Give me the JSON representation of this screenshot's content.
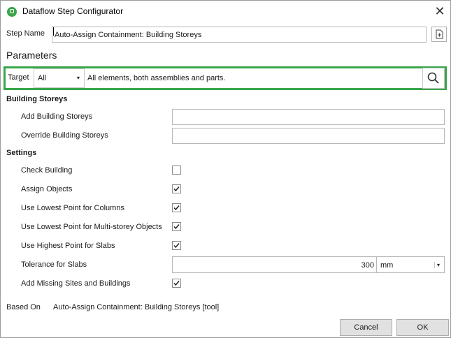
{
  "window": {
    "title": "Dataflow Step Configurator"
  },
  "step": {
    "label": "Step Name",
    "value": "Auto-Assign Containment: Building Storeys"
  },
  "parameters": {
    "heading": "Parameters"
  },
  "target": {
    "label": "Target",
    "selected": "All",
    "description": "All elements, both assemblies and parts."
  },
  "storeys": {
    "heading": "Building Storeys",
    "add_label": "Add Building Storeys",
    "add_value": "",
    "override_label": "Override Building Storeys",
    "override_value": ""
  },
  "settings": {
    "heading": "Settings",
    "check_building": {
      "label": "Check Building",
      "checked": false
    },
    "assign_objects": {
      "label": "Assign Objects",
      "checked": true
    },
    "lowest_columns": {
      "label": "Use Lowest Point for Columns",
      "checked": true
    },
    "lowest_multistorey": {
      "label": "Use Lowest Point for Multi-storey Objects",
      "checked": true
    },
    "highest_slabs": {
      "label": "Use Highest Point for Slabs",
      "checked": true
    },
    "tolerance": {
      "label": "Tolerance for Slabs",
      "value": "300",
      "unit": "mm"
    },
    "missing_sites": {
      "label": "Add Missing Sites and Buildings",
      "checked": true
    }
  },
  "based_on": {
    "label": "Based On",
    "value": "Auto-Assign Containment: Building Storeys [tool]"
  },
  "buttons": {
    "cancel": "Cancel",
    "ok": "OK"
  },
  "colors": {
    "accent": "#3aa64a"
  }
}
